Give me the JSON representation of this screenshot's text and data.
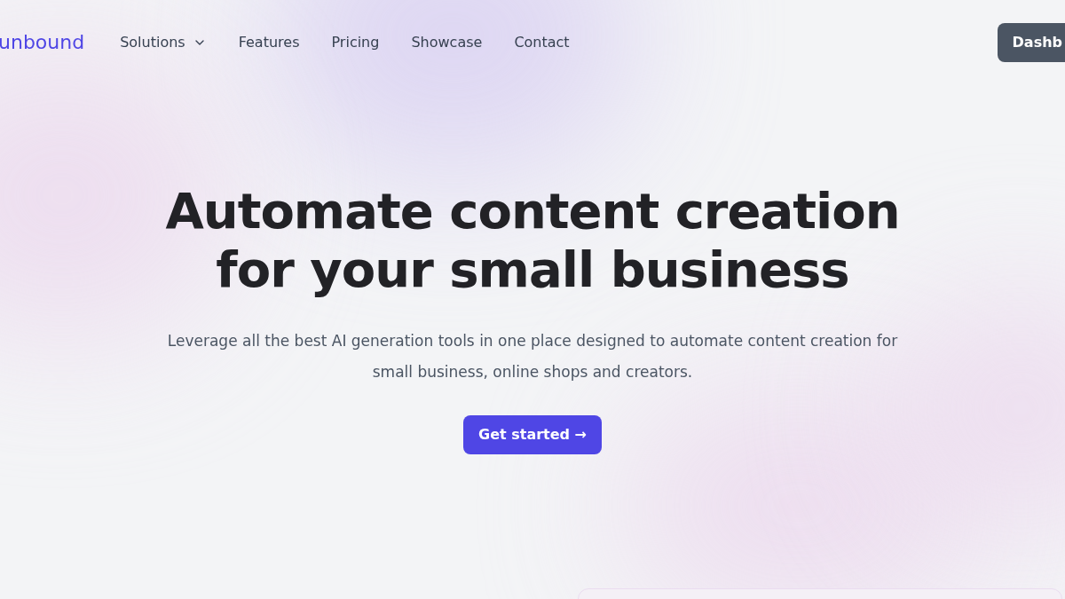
{
  "nav": {
    "logo": "unbound",
    "items": [
      {
        "label": "Solutions",
        "has_menu": true
      },
      {
        "label": "Features",
        "has_menu": false
      },
      {
        "label": "Pricing",
        "has_menu": false
      },
      {
        "label": "Showcase",
        "has_menu": false
      },
      {
        "label": "Contact",
        "has_menu": false
      }
    ],
    "button": "Dashb"
  },
  "hero": {
    "title_lines": [
      "Automate content creation",
      "for your small business"
    ],
    "subtitle": "Leverage all the best AI generation tools in one place designed to automate content creation for small business, online shops and creators.",
    "cta": "Get started →"
  }
}
